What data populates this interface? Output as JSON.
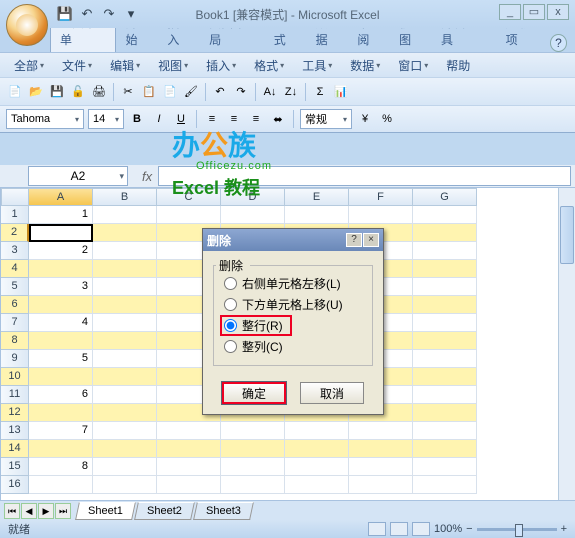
{
  "title": "Book1 [兼容模式] - Microsoft Excel",
  "qat": {
    "save": "💾",
    "undo": "↶",
    "redo": "↷",
    "more": "▾"
  },
  "winctl": {
    "min": "_",
    "max": "▭",
    "close": "x"
  },
  "tabs": [
    "经典菜单",
    "开始",
    "插入",
    "页面布局",
    "公式",
    "数据",
    "审阅",
    "视图",
    "开发工具",
    "加载项"
  ],
  "menus": [
    "全部",
    "文件",
    "编辑",
    "视图",
    "插入",
    "格式",
    "工具",
    "数据",
    "窗口",
    "帮助"
  ],
  "format": {
    "font": "Tahoma",
    "size": "14",
    "style": "常规"
  },
  "namebox": "A2",
  "fx": "fx",
  "columns": [
    "A",
    "B",
    "C",
    "D",
    "E",
    "F",
    "G"
  ],
  "rowdata": [
    {
      "n": "1",
      "v": "1",
      "y": false
    },
    {
      "n": "2",
      "v": "",
      "y": true,
      "active": true
    },
    {
      "n": "3",
      "v": "2",
      "y": false
    },
    {
      "n": "4",
      "v": "",
      "y": true
    },
    {
      "n": "5",
      "v": "3",
      "y": false
    },
    {
      "n": "6",
      "v": "",
      "y": true
    },
    {
      "n": "7",
      "v": "4",
      "y": false
    },
    {
      "n": "8",
      "v": "",
      "y": true
    },
    {
      "n": "9",
      "v": "5",
      "y": false
    },
    {
      "n": "10",
      "v": "",
      "y": true
    },
    {
      "n": "11",
      "v": "6",
      "y": false
    },
    {
      "n": "12",
      "v": "",
      "y": true
    },
    {
      "n": "13",
      "v": "7",
      "y": false
    },
    {
      "n": "14",
      "v": "",
      "y": true
    },
    {
      "n": "15",
      "v": "8",
      "y": false
    },
    {
      "n": "16",
      "v": "",
      "y": false
    }
  ],
  "sheets": [
    "Sheet1",
    "Sheet2",
    "Sheet3"
  ],
  "status": {
    "ready": "就绪",
    "zoom": "100%"
  },
  "dialog": {
    "title": "删除",
    "group": "删除",
    "opts": {
      "shiftLeft": "右侧单元格左移(L)",
      "shiftUp": "下方单元格上移(U)",
      "entireRow": "整行(R)",
      "entireCol": "整列(C)"
    },
    "ok": "确定",
    "cancel": "取消"
  },
  "watermark": {
    "l1a": "办",
    "l1b": "公",
    "l1c": "族",
    "url": "Officezu.com",
    "l3": "Excel 教程"
  }
}
